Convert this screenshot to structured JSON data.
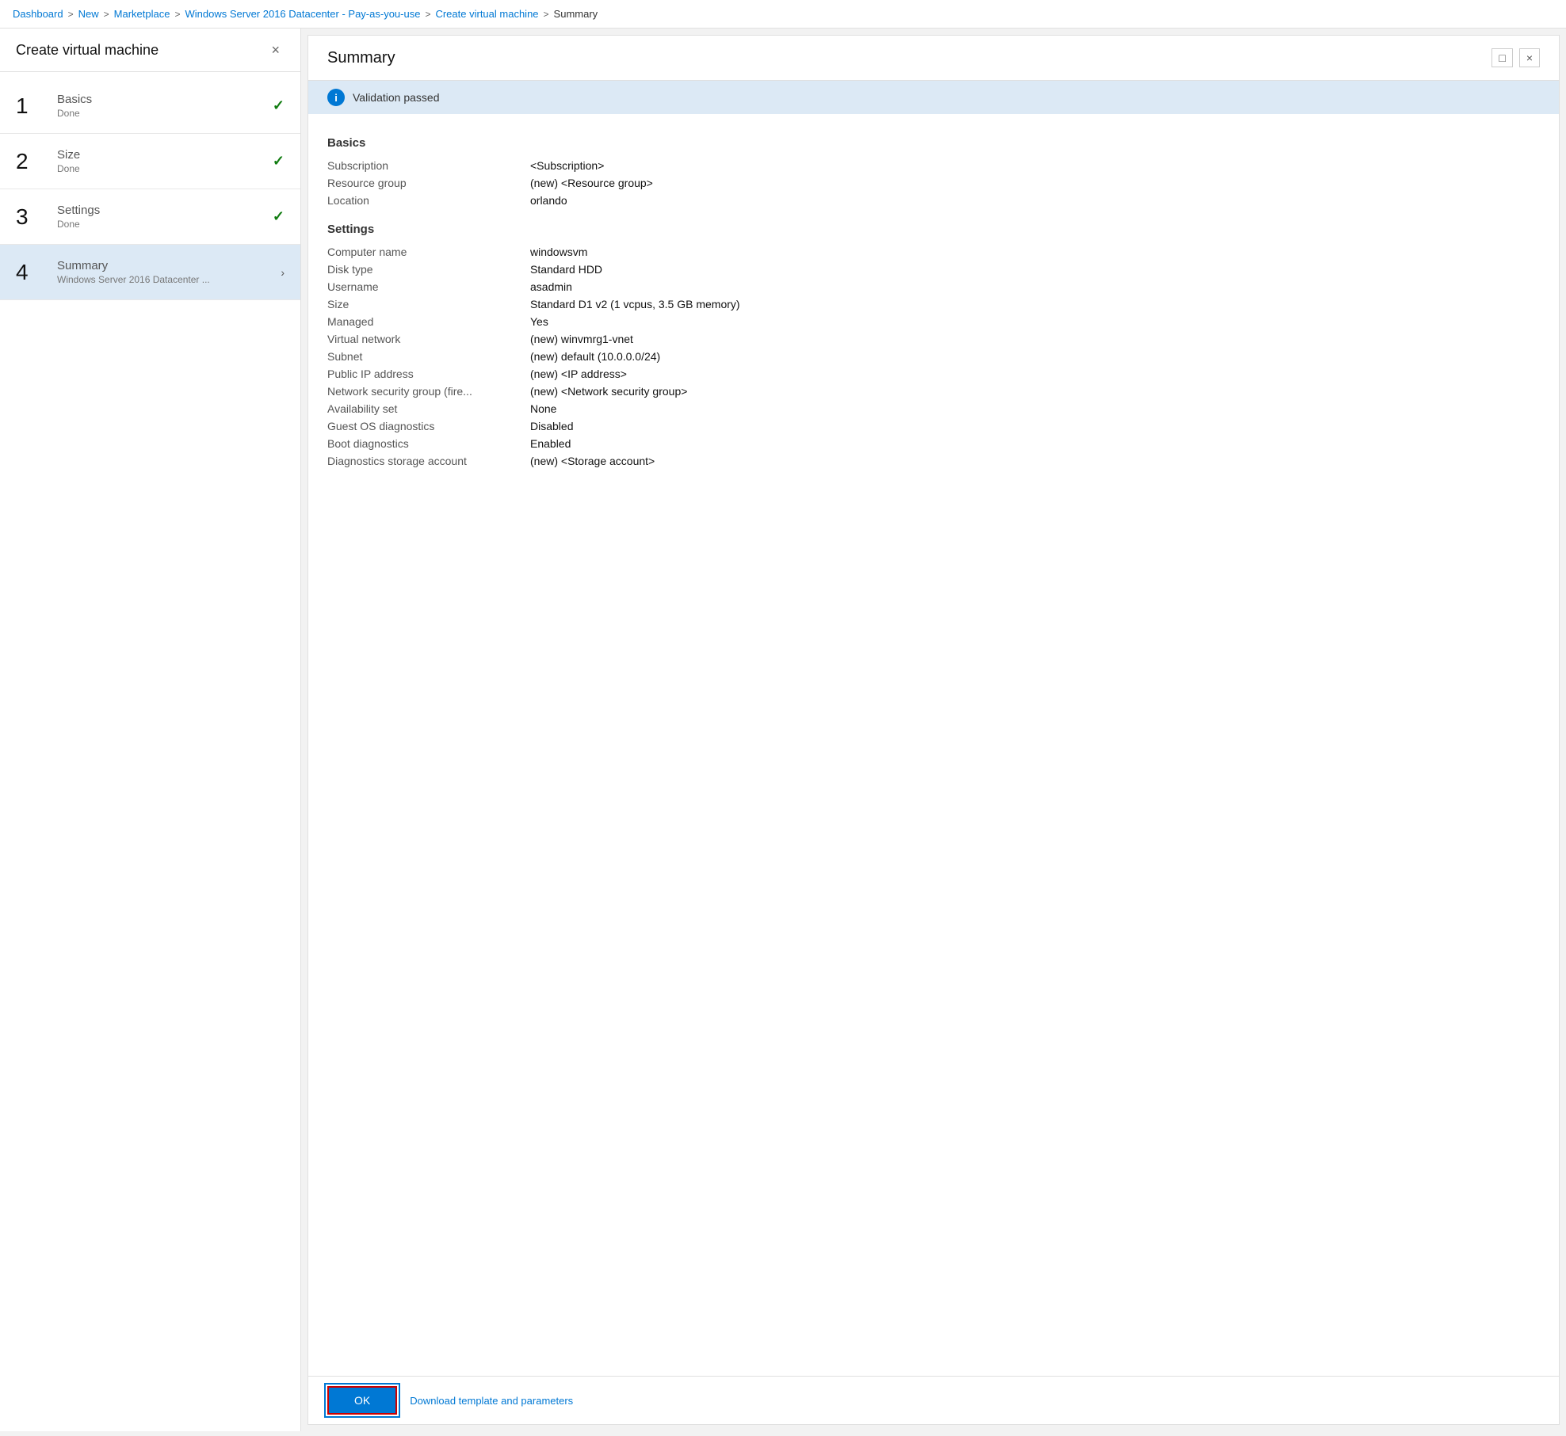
{
  "breadcrumb": {
    "items": [
      {
        "label": "Dashboard",
        "link": true
      },
      {
        "label": "New",
        "link": true
      },
      {
        "label": "Marketplace",
        "link": true
      },
      {
        "label": "Windows Server 2016 Datacenter - Pay-as-you-use",
        "link": true
      },
      {
        "label": "Create virtual machine",
        "link": true
      },
      {
        "label": "Summary",
        "link": false
      }
    ],
    "separator": ">"
  },
  "left_panel": {
    "title": "Create virtual machine",
    "close_label": "×",
    "steps": [
      {
        "number": "1",
        "label": "Basics",
        "sublabel": "Done",
        "status": "done",
        "check": "✓"
      },
      {
        "number": "2",
        "label": "Size",
        "sublabel": "Done",
        "status": "done",
        "check": "✓"
      },
      {
        "number": "3",
        "label": "Settings",
        "sublabel": "Done",
        "status": "done",
        "check": "✓"
      },
      {
        "number": "4",
        "label": "Summary",
        "sublabel": "Windows Server 2016 Datacenter ...",
        "status": "active",
        "check": ""
      }
    ]
  },
  "right_panel": {
    "title": "Summary",
    "maximize_label": "□",
    "close_label": "×",
    "validation": {
      "icon": "i",
      "message": "Validation passed"
    },
    "basics_section": {
      "heading": "Basics",
      "rows": [
        {
          "key": "Subscription",
          "value": "<Subscription>"
        },
        {
          "key": "Resource group",
          "value": "(new) <Resource group>"
        },
        {
          "key": "Location",
          "value": "orlando"
        }
      ]
    },
    "settings_section": {
      "heading": "Settings",
      "rows": [
        {
          "key": "Computer name",
          "value": "windowsvm"
        },
        {
          "key": "Disk type",
          "value": "Standard HDD"
        },
        {
          "key": "Username",
          "value": "asadmin"
        },
        {
          "key": "Size",
          "value": "Standard D1 v2 (1 vcpus, 3.5 GB memory)"
        },
        {
          "key": "Managed",
          "value": "Yes"
        },
        {
          "key": "Virtual network",
          "value": "(new) winvmrg1-vnet"
        },
        {
          "key": "Subnet",
          "value": "(new) default (10.0.0.0/24)"
        },
        {
          "key": "Public IP address",
          "value": "(new) <IP address>"
        },
        {
          "key": "Network security group (fire...",
          "value": "(new) <Network security group>"
        },
        {
          "key": "Availability set",
          "value": "None"
        },
        {
          "key": "Guest OS diagnostics",
          "value": "Disabled"
        },
        {
          "key": "Boot diagnostics",
          "value": "Enabled"
        },
        {
          "key": "Diagnostics storage account",
          "value": "(new) <Storage account>"
        }
      ]
    },
    "bottom": {
      "ok_label": "OK",
      "download_label": "Download template and parameters"
    }
  }
}
